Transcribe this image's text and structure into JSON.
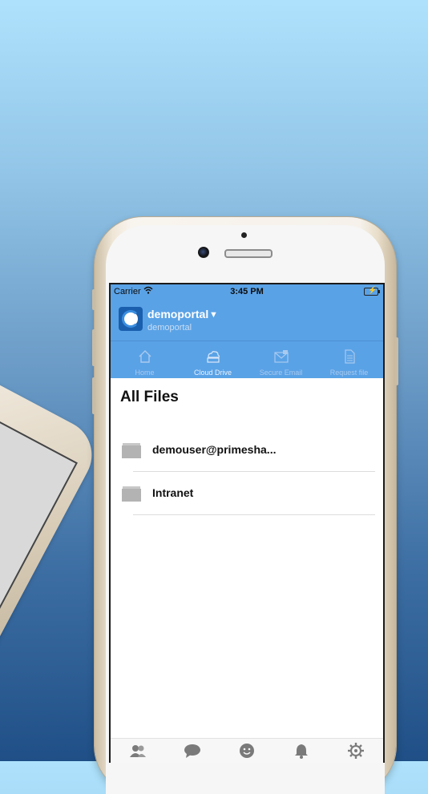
{
  "status_bar": {
    "carrier": "Carrier",
    "time": "3:45 PM"
  },
  "header": {
    "title": "demoportal",
    "subtitle": "demoportal",
    "accent_color": "#5aa2e6"
  },
  "tabs": [
    {
      "label": "Home",
      "icon": "home-icon",
      "active": false
    },
    {
      "label": "Cloud Drive",
      "icon": "cloud-drive-icon",
      "active": true
    },
    {
      "label": "Secure Email",
      "icon": "secure-email-icon",
      "active": false
    },
    {
      "label": "Request file",
      "icon": "request-file-icon",
      "active": false
    }
  ],
  "main": {
    "title": "All Files",
    "items": [
      {
        "name": "demouser@primesha...",
        "icon": "folder-icon"
      },
      {
        "name": "Intranet",
        "icon": "folder-icon"
      }
    ]
  },
  "bottom_bar": [
    {
      "icon": "contacts-icon"
    },
    {
      "icon": "chat-icon"
    },
    {
      "icon": "emoji-icon"
    },
    {
      "icon": "bell-icon"
    },
    {
      "icon": "settings-gear-icon"
    }
  ]
}
